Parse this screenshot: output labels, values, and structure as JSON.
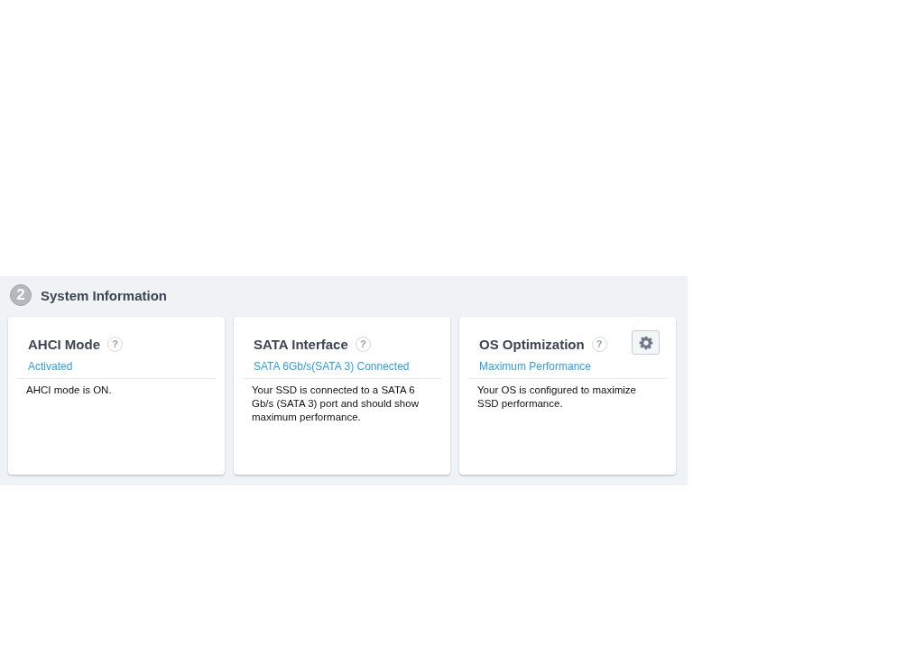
{
  "section": {
    "number": "2",
    "title": "System Information"
  },
  "cards": [
    {
      "title": "AHCI Mode",
      "help": "?",
      "status": "Activated",
      "description": "AHCI mode is ON.",
      "settings_button": false
    },
    {
      "title": "SATA Interface",
      "help": "?",
      "status": "SATA 6Gb/s(SATA 3) Connected",
      "description": "Your SSD is connected to a SATA 6 Gb/s (SATA 3) port and should show maximum performance.",
      "settings_button": false
    },
    {
      "title": "OS Optimization",
      "help": "?",
      "status": "Maximum Performance",
      "description": "Your OS is configured to maximize SSD performance.",
      "settings_button": true
    }
  ]
}
